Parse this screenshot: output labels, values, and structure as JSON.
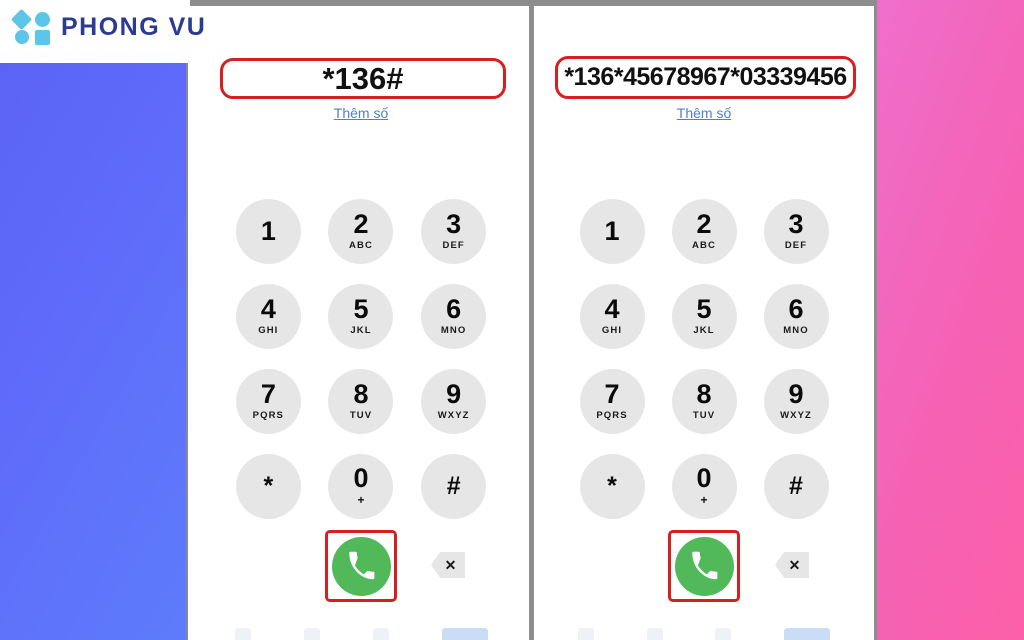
{
  "brand": {
    "name": "PHONG VU",
    "mark_shapes": [
      "diamond-icon",
      "circle-icon",
      "circle-icon",
      "square-icon"
    ],
    "text_color": "#2c3b8f",
    "mark_color": "#5cc5e8"
  },
  "colors": {
    "annotation_red": "#d61f20",
    "call_green": "#51b95a",
    "key_gray": "#e6e6e6",
    "link_blue": "#5180bd",
    "left_panel_blue": "#5b63f5",
    "right_panel_pink": "#f562b4",
    "divider_gray": "#8d8d8d"
  },
  "keypad_keys": [
    {
      "digit": "1",
      "letters": ""
    },
    {
      "digit": "2",
      "letters": "ABC"
    },
    {
      "digit": "3",
      "letters": "DEF"
    },
    {
      "digit": "4",
      "letters": "GHI"
    },
    {
      "digit": "5",
      "letters": "JKL"
    },
    {
      "digit": "6",
      "letters": "MNO"
    },
    {
      "digit": "7",
      "letters": "PQRS"
    },
    {
      "digit": "8",
      "letters": "TUV"
    },
    {
      "digit": "9",
      "letters": "WXYZ"
    },
    {
      "digit": "*",
      "letters": ""
    },
    {
      "digit": "0",
      "letters": "+"
    },
    {
      "digit": "#",
      "letters": ""
    }
  ],
  "phones": [
    {
      "id": "phone-left",
      "dialed_number": "*136#",
      "add_number_link": "Thêm số",
      "call_button_label": "call-button",
      "backspace_label": "backspace"
    },
    {
      "id": "phone-right",
      "dialed_number": "*136*45678967*03339456",
      "add_number_link": "Thêm số",
      "call_button_label": "call-button",
      "backspace_label": "backspace"
    }
  ]
}
